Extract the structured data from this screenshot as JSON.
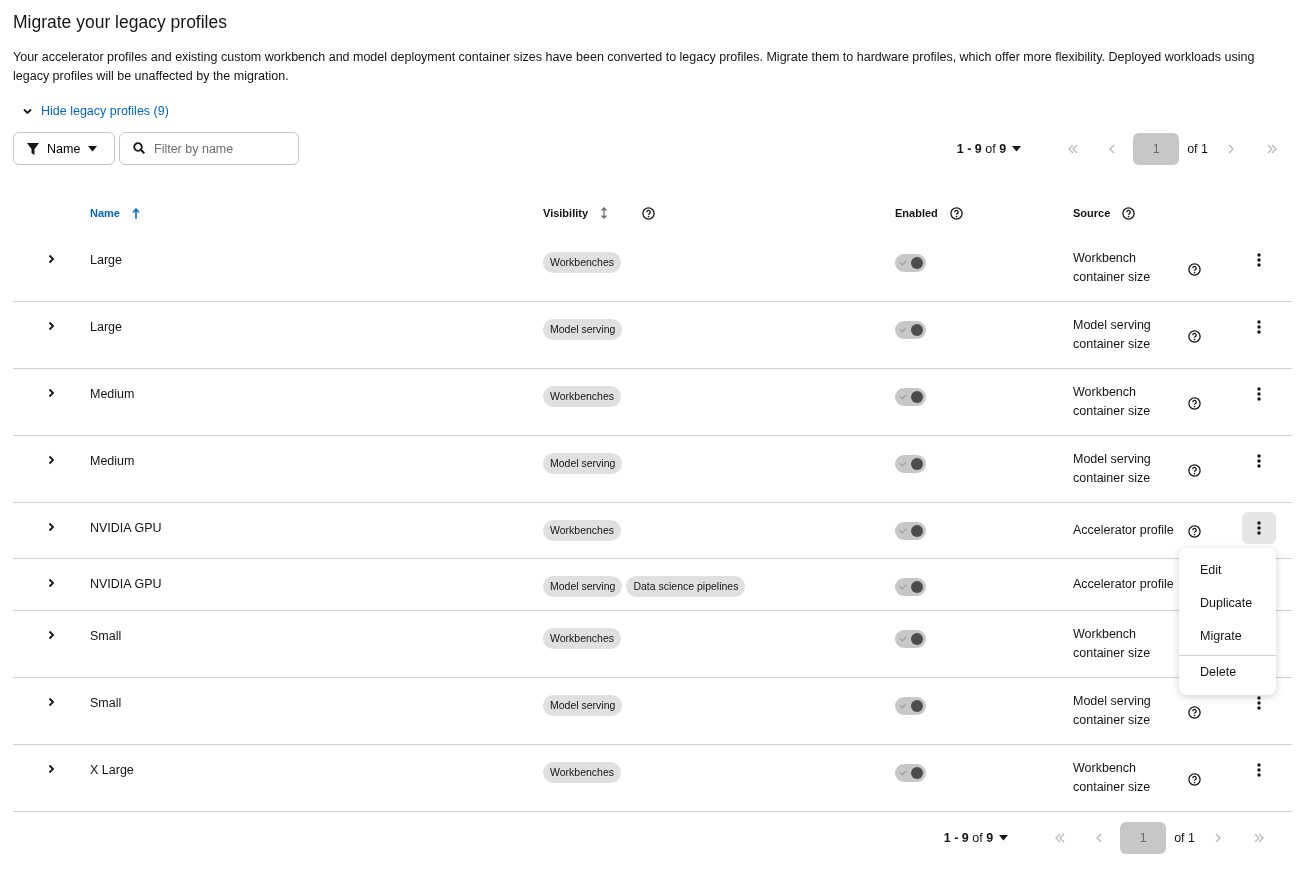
{
  "title": "Migrate your legacy profiles",
  "description": "Your accelerator profiles and existing custom workbench and model deployment container sizes have been converted to legacy profiles. Migrate them to hardware profiles, which offer more flexibility. Deployed workloads using legacy profiles will be unaffected by the migration.",
  "toggle_link": {
    "label": "Hide legacy profiles (9)",
    "expanded": true
  },
  "toolbar": {
    "filter_attribute": "Name",
    "search": {
      "placeholder": "Filter by name"
    }
  },
  "pagination_top": {
    "range": "1 - 9",
    "of_label": "of",
    "total": "9",
    "page": "1",
    "page_count": "of 1",
    "nav": [
      {
        "kind": "first",
        "disabled": true
      },
      {
        "kind": "prev",
        "disabled": true
      },
      {
        "kind": "next",
        "disabled": true
      },
      {
        "kind": "last",
        "disabled": true
      }
    ]
  },
  "table": {
    "columns": [
      {
        "label": "Name",
        "sortable": true,
        "sorted": true,
        "help": false
      },
      {
        "label": "Visibility",
        "sortable": true,
        "sorted": false,
        "help": true
      },
      {
        "label": "Enabled",
        "sortable": false,
        "sorted": false,
        "help": true
      },
      {
        "label": "Source",
        "sortable": false,
        "sorted": false,
        "help": true
      }
    ],
    "rows": [
      {
        "name": "Large",
        "visibility": [
          "Workbenches"
        ],
        "enabled": true,
        "disabled": true,
        "source": [
          "Workbench",
          "container size"
        ],
        "menu_active": false,
        "covered": false
      },
      {
        "name": "Large",
        "visibility": [
          "Model serving"
        ],
        "enabled": true,
        "disabled": true,
        "source": [
          "Model serving",
          "container size"
        ],
        "menu_active": false,
        "covered": false
      },
      {
        "name": "Medium",
        "visibility": [
          "Workbenches"
        ],
        "enabled": true,
        "disabled": true,
        "source": [
          "Workbench",
          "container size"
        ],
        "menu_active": false,
        "covered": false
      },
      {
        "name": "Medium",
        "visibility": [
          "Model serving"
        ],
        "enabled": true,
        "disabled": true,
        "source": [
          "Model serving",
          "container size"
        ],
        "menu_active": false,
        "covered": false
      },
      {
        "name": "NVIDIA GPU",
        "visibility": [
          "Workbenches"
        ],
        "enabled": true,
        "disabled": true,
        "source": [
          "Accelerator profile"
        ],
        "menu_active": true,
        "covered": false
      },
      {
        "name": "NVIDIA GPU",
        "visibility": [
          "Model serving",
          "Data science pipelines"
        ],
        "enabled": true,
        "disabled": true,
        "source": [
          "Accelerator profile"
        ],
        "menu_active": false,
        "covered": true
      },
      {
        "name": "Small",
        "visibility": [
          "Workbenches"
        ],
        "enabled": true,
        "disabled": true,
        "source": [
          "Workbench",
          "container size"
        ],
        "menu_active": false,
        "covered": true
      },
      {
        "name": "Small",
        "visibility": [
          "Model serving"
        ],
        "enabled": true,
        "disabled": true,
        "source": [
          "Model serving",
          "container size"
        ],
        "menu_active": false,
        "covered": false
      },
      {
        "name": "X Large",
        "visibility": [
          "Workbenches"
        ],
        "enabled": true,
        "disabled": true,
        "source": [
          "Workbench",
          "container size"
        ],
        "menu_active": false,
        "covered": false
      }
    ]
  },
  "actions_menu": {
    "items": [
      {
        "label": "Edit",
        "separator_before": false
      },
      {
        "label": "Duplicate",
        "separator_before": false
      },
      {
        "label": "Migrate",
        "separator_before": false
      },
      {
        "label": "Delete",
        "separator_before": true
      }
    ]
  },
  "pagination_bottom": {
    "range": "1 - 9",
    "of_label": "of",
    "total": "9",
    "page": "1",
    "page_count": "of 1",
    "nav": [
      {
        "kind": "first",
        "disabled": true
      },
      {
        "kind": "prev",
        "disabled": true
      },
      {
        "kind": "next",
        "disabled": true
      },
      {
        "kind": "last",
        "disabled": true
      }
    ]
  }
}
